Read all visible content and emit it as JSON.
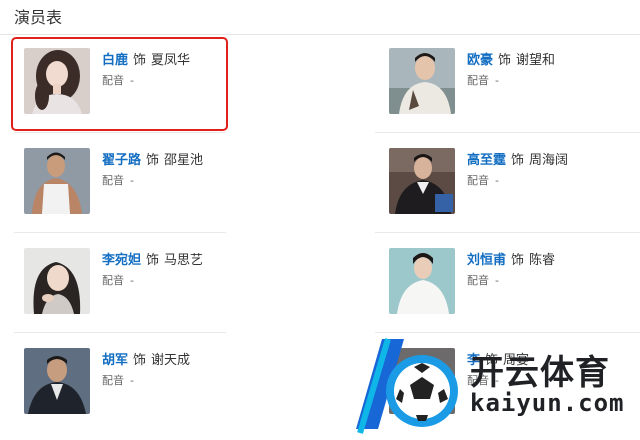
{
  "section": {
    "title": "演员表"
  },
  "cast": [
    {
      "actor": "白鹿",
      "connector": "饰",
      "role": "夏凤华",
      "voice_label": "配音",
      "voice_value": "-"
    },
    {
      "actor": "欧豪",
      "connector": "饰",
      "role": "谢望和",
      "voice_label": "配音",
      "voice_value": "-"
    },
    {
      "actor": "翟子路",
      "connector": "饰",
      "role": "邵星池",
      "voice_label": "配音",
      "voice_value": "-"
    },
    {
      "actor": "高至霆",
      "connector": "饰",
      "role": "周海阔",
      "voice_label": "配音",
      "voice_value": "-"
    },
    {
      "actor": "李宛妲",
      "connector": "饰",
      "role": "马思艺",
      "voice_label": "配音",
      "voice_value": "-"
    },
    {
      "actor": "刘恒甫",
      "connector": "饰",
      "role": "陈睿",
      "voice_label": "配音",
      "voice_value": "-"
    },
    {
      "actor": "胡军",
      "connector": "饰",
      "role": "谢天成",
      "voice_label": "配音",
      "voice_value": "-"
    },
    {
      "actor": "李",
      "connector": "饰",
      "role": "周宴",
      "voice_label": "配音",
      "voice_value": "-"
    }
  ],
  "watermark": {
    "brand_cn": "开云体育",
    "brand_url": "kaiyun.com"
  },
  "colors": {
    "actor_link": "#136ec2",
    "highlight_border": "#e0211a",
    "divider": "#e9e9e9"
  }
}
